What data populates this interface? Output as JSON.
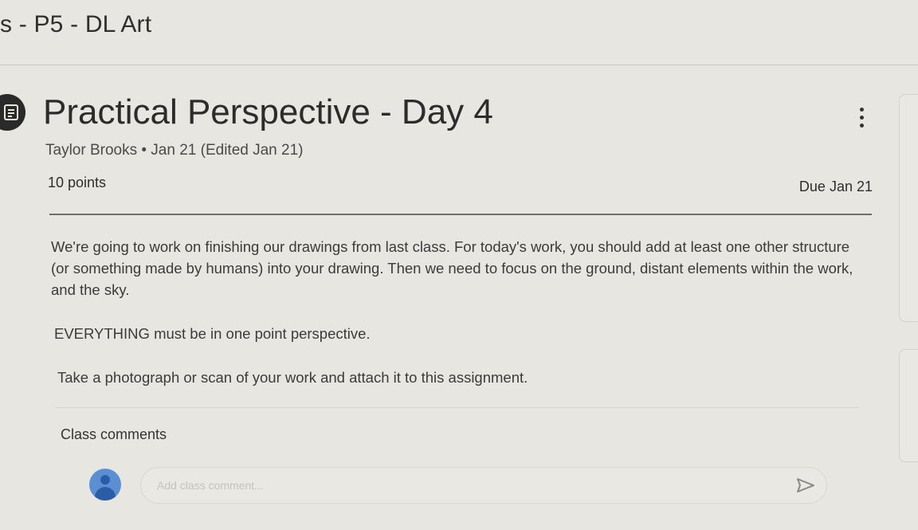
{
  "header": {
    "title": "s - P5 - DL Art"
  },
  "assignment": {
    "icon": "assignment-icon",
    "title": "Practical Perspective - Day 4",
    "meta": "Taylor Brooks • Jan 21 (Edited Jan 21)",
    "points": "10 points",
    "due": "Due Jan 21",
    "description": "We're going to work on finishing our drawings from last class. For today's work, you should add at least one other structure (or something made by humans) into your drawing. Then we need to focus on the ground, distant elements within the work, and the sky.",
    "paragraph2": "EVERYTHING must be in one point perspective.",
    "paragraph3": "Take a photograph or scan of your work and attach it to this assignment."
  },
  "comments": {
    "label": "Class comments",
    "placeholder": "Add class comment...",
    "send_icon": "send-icon"
  },
  "colors": {
    "text": "#3c3c3c",
    "avatar": "#5b8fd3",
    "background": "#e7e6e1"
  }
}
